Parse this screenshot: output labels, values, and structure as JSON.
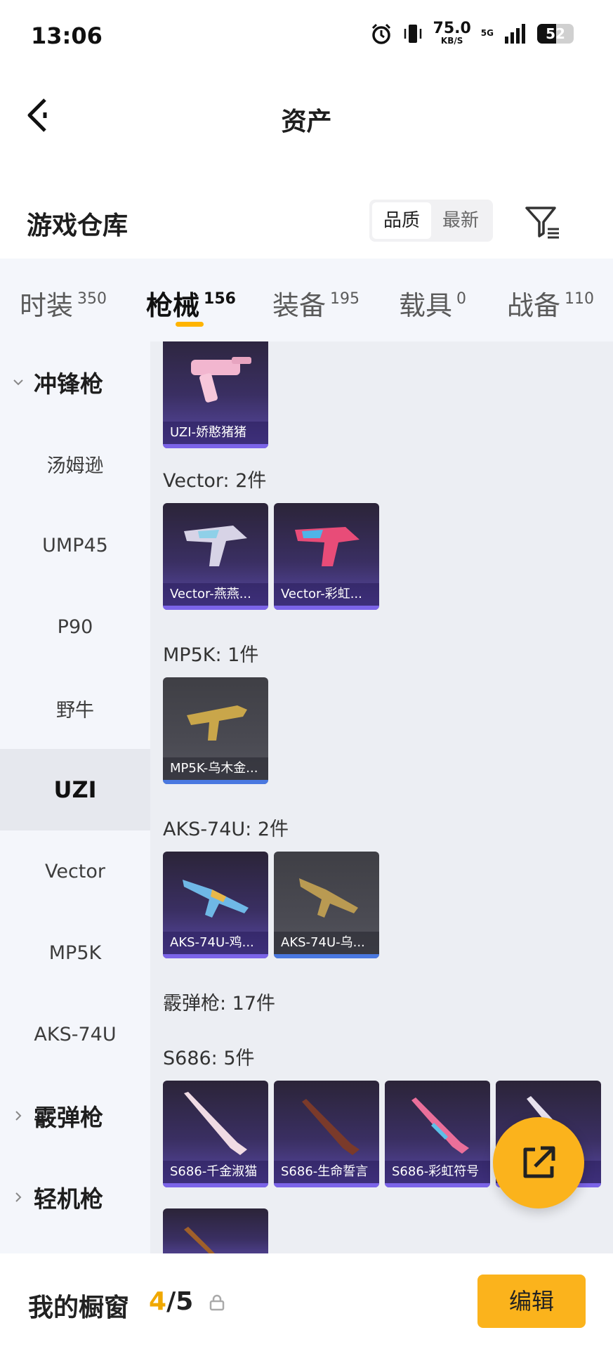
{
  "status_bar": {
    "time": "13:06",
    "net_speed": "75.0",
    "net_unit": "KB/S",
    "network": "5G",
    "battery": "52"
  },
  "header": {
    "title": "资产"
  },
  "warehouse": {
    "title": "游戏仓库",
    "sort_options": [
      "品质",
      "最新"
    ],
    "active_sort": "品质"
  },
  "tabs": [
    {
      "label": "时装",
      "count": "350"
    },
    {
      "label": "枪械",
      "count": "156"
    },
    {
      "label": "装备",
      "count": "195"
    },
    {
      "label": "载具",
      "count": "0"
    },
    {
      "label": "战备",
      "count": "110"
    }
  ],
  "active_tab": "枪械",
  "sidebar": {
    "items": [
      {
        "label": "冲锋枪"
      },
      {
        "label": "汤姆逊"
      },
      {
        "label": "UMP45"
      },
      {
        "label": "P90"
      },
      {
        "label": "野牛"
      },
      {
        "label": "UZI"
      },
      {
        "label": "Vector"
      },
      {
        "label": "MP5K"
      },
      {
        "label": "AKS-74U"
      },
      {
        "label": "霰弹枪"
      },
      {
        "label": "轻机枪"
      }
    ]
  },
  "sections": [
    {
      "label": "",
      "cards": [
        {
          "name": "UZI-娇憨猪猪"
        }
      ]
    },
    {
      "label": "Vector: 2件",
      "cards": [
        {
          "name": "Vector-燕燕..."
        },
        {
          "name": "Vector-彩虹..."
        }
      ]
    },
    {
      "label": "MP5K: 1件",
      "cards": [
        {
          "name": "MP5K-乌木金..."
        }
      ]
    },
    {
      "label": "AKS-74U: 2件",
      "cards": [
        {
          "name": "AKS-74U-鸡..."
        },
        {
          "name": "AKS-74U-乌..."
        }
      ]
    },
    {
      "label": "霰弹枪: 17件",
      "cards": []
    },
    {
      "label": "S686: 5件",
      "cards": [
        {
          "name": "S686-千金淑猫"
        },
        {
          "name": "S686-生命誓言"
        },
        {
          "name": "S686-彩虹符号"
        },
        {
          "name": "S686-...意"
        }
      ]
    }
  ],
  "bottom": {
    "title": "我的橱窗",
    "current": "4",
    "sep_total": "/5",
    "edit_label": "编辑"
  },
  "colors": {
    "accent": "#fbb31c",
    "purple_card": "#3a2f62",
    "gray_card": "#4a4a52",
    "sidebar_bg": "#f4f6fb"
  },
  "icons": [
    "alarm-icon",
    "vibrate-icon",
    "signal-icon",
    "battery-icon",
    "back-icon",
    "filter-icon",
    "lock-icon",
    "share-icon"
  ]
}
